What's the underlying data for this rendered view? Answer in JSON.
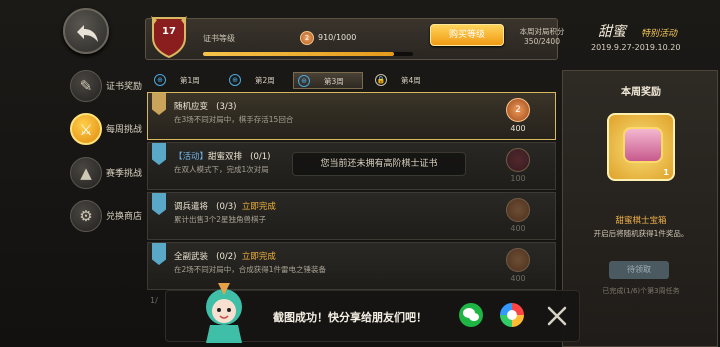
{
  "nav": {
    "items": [
      {
        "label": "证书奖励",
        "icon": "certificate-icon",
        "glyph": "✎"
      },
      {
        "label": "每周挑战",
        "icon": "challenge-icon",
        "glyph": "⚔"
      },
      {
        "label": "赛季挑战",
        "icon": "mountain-icon",
        "glyph": "▲"
      },
      {
        "label": "兑换商店",
        "icon": "shop-icon",
        "glyph": "⚙"
      }
    ]
  },
  "header": {
    "level": "17",
    "level_label": "证书等级",
    "xp_icon_num": "2",
    "xp": "910/1000",
    "xp_fraction": 0.91,
    "buy_label": "购买等级",
    "weekly_label": "本周对局积分",
    "weekly_value": "350/2400"
  },
  "event": {
    "title": "甜蜜",
    "subtitle": "特别活动",
    "date": "2019.9.27-2019.10.20"
  },
  "tabs": [
    {
      "label": "第1周",
      "icon": "target-icon",
      "symbol": "⊕"
    },
    {
      "label": "第2周",
      "icon": "target-icon",
      "symbol": "⊕"
    },
    {
      "label": "第3周",
      "icon": "target-icon",
      "symbol": "⊕"
    },
    {
      "label": "第4周",
      "icon": "lock-icon",
      "symbol": "🔒"
    }
  ],
  "tasks": [
    {
      "title": "随机应变",
      "progress": "(3/3)",
      "desc": "在3场不同对局中，棋手存活15回合",
      "reward": "400",
      "reward_num": "2"
    },
    {
      "prefix": "【活动】",
      "title": "甜蜜双排",
      "progress": "(0/1)",
      "desc": "在双人模式下，完成1次对局",
      "reward": "100"
    },
    {
      "title": "调兵遣将",
      "progress": "(0/3)",
      "go": "立即完成",
      "desc": "累计出售3个2星独角兽棋子",
      "reward": "400"
    },
    {
      "title": "全副武装",
      "progress": "(0/2)",
      "go": "立即完成",
      "desc": "在2场不同对局中，合成获得1件雷电之锤装备",
      "reward": "400"
    }
  ],
  "toast": "您当前还未拥有高阶棋士证书",
  "reward_panel": {
    "title": "本周奖励",
    "item_name": "甜蜜棋士宝箱",
    "item_desc": "开启后将随机获得1件奖品。",
    "item_qty": "1",
    "wait_label": "待领取",
    "progress": "已完成(1/6)个第3周任务"
  },
  "share": {
    "text": "截图成功！快分享给朋友们吧！",
    "wechat_icon": "wechat-icon",
    "photos_icon": "photos-icon",
    "close_icon": "close-icon"
  },
  "partial_row": "1/"
}
